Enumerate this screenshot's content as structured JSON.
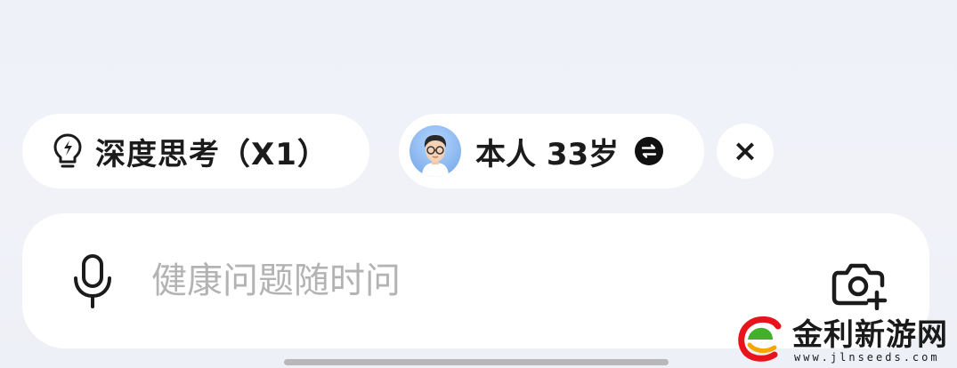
{
  "chips": {
    "thinking": {
      "label": "深度思考（X1）",
      "icon": "bulb-lightning-icon"
    },
    "profile": {
      "label": "本人 33岁",
      "avatar": "avatar",
      "icon": "swap-icon"
    }
  },
  "close": {
    "symbol": "×",
    "icon": "close-icon"
  },
  "input": {
    "placeholder": "健康问题随时问",
    "left_icon": "microphone-icon",
    "right_icon": "camera-plus-icon"
  },
  "watermark": {
    "title": "金利新游网",
    "url": "www.jlnseeds.com"
  },
  "colors": {
    "background": "#eef1f7",
    "surface": "#ffffff",
    "text": "#1b1b1b",
    "placeholder": "#b3b3b3"
  }
}
